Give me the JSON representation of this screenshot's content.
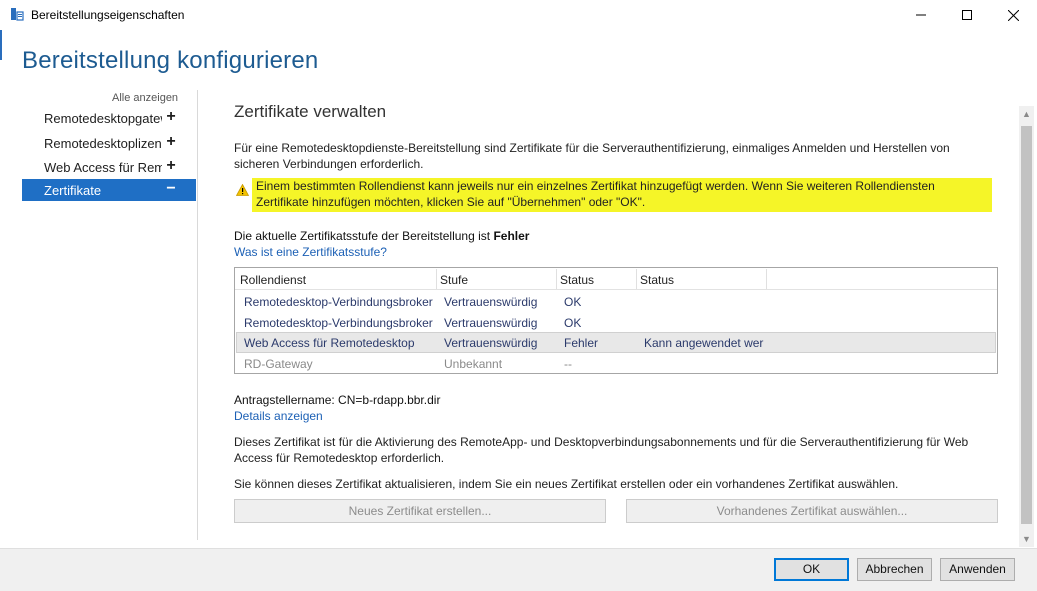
{
  "window": {
    "title": "Bereitstellungseigenschaften"
  },
  "page_title": "Bereitstellung konfigurieren",
  "sidebar": {
    "show_all": "Alle anzeigen",
    "items": [
      {
        "label": "Remotedesktopgateway",
        "sign": "+"
      },
      {
        "label": "Remotedesktoplizenzierung",
        "sign": "+"
      },
      {
        "label": "Web Access für Remotedesktop",
        "sign": "+"
      },
      {
        "label": "Zertifikate",
        "sign": "−",
        "active": true
      }
    ]
  },
  "content": {
    "section_title": "Zertifikate verwalten",
    "intro": "Für eine Remotedesktopdienste-Bereitstellung sind Zertifikate für die Serverauthentifizierung, einmaliges Anmelden und Herstellen von sicheren Verbindungen erforderlich.",
    "warning": "Einem bestimmten Rollendienst kann jeweils nur ein einzelnes Zertifikat hinzugefügt werden. Wenn Sie weiteren Rollendiensten Zertifikate hinzufügen möchten, klicken Sie auf \"Übernehmen\" oder \"OK\".",
    "cert_level_prefix": "Die aktuelle Zertifikatsstufe der Bereitstellung ist ",
    "cert_level_value": "Fehler",
    "cert_level_link": "Was ist eine Zertifikatsstufe?",
    "table": {
      "headers": [
        "Rollendienst",
        "Stufe",
        "Status",
        "Status"
      ],
      "rows": [
        {
          "role": "Remotedesktop-Verbindungsbroker",
          "level": "Vertrauenswürdig",
          "status": "OK",
          "status2": ""
        },
        {
          "role": "Remotedesktop-Verbindungsbroker",
          "level": "Vertrauenswürdig",
          "status": "OK",
          "status2": ""
        },
        {
          "role": "Web Access für Remotedesktop",
          "level": "Vertrauenswürdig",
          "status": "Fehler",
          "status2": "Kann angewendet wer"
        },
        {
          "role": "RD-Gateway",
          "level": "Unbekannt",
          "status": "--",
          "status2": ""
        }
      ]
    },
    "applicant": "Antragstellername: CN=b-rdapp.bbr.dir",
    "details_link": "Details anzeigen",
    "description": "Dieses Zertifikat ist für die Aktivierung des RemoteApp- und Desktopverbindungsabonnements und für die Serverauthentifizierung für Web Access für Remotedesktop erforderlich.",
    "update_hint": "Sie können dieses Zertifikat aktualisieren, indem Sie ein neues Zertifikat erstellen oder ein vorhandenes Zertifikat auswählen.",
    "btn_new": "Neues Zertifikat erstellen...",
    "btn_existing": "Vorhandenes Zertifikat auswählen..."
  },
  "footer": {
    "ok": "OK",
    "cancel": "Abbrechen",
    "apply": "Anwenden"
  },
  "colors": {
    "accent": "#1f6fc5",
    "title": "#1d5b91",
    "warning_highlight": "#f5f528"
  }
}
